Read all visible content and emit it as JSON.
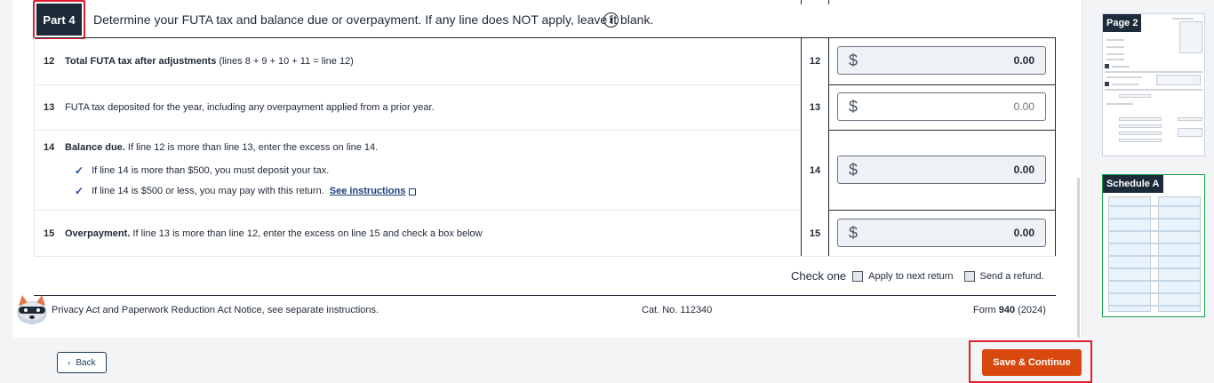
{
  "part": {
    "badge": "Part 4",
    "title": "Determine your FUTA tax and balance due or overpayment. If any line does NOT apply, leave it blank.",
    "info_icon": "info-circle-icon"
  },
  "lines": [
    {
      "num": "12",
      "bold": "Total FUTA tax after adjustments",
      "text": " (lines 8 + 9 + 10 + 11 = line 12)",
      "code": "12",
      "currency": "$",
      "amount": "0.00"
    },
    {
      "num": "13",
      "bold": "",
      "text": "FUTA tax deposited for the year, including any overpayment applied from a prior year.",
      "code": "13",
      "currency": "$",
      "amount": "0.00"
    },
    {
      "num": "14",
      "bold": "Balance due.",
      "text": " If line 12 is more than line 13, enter the excess on line 14.",
      "code": "14",
      "currency": "$",
      "amount": "0.00",
      "bullets": [
        "If line 14 is more than $500, you must deposit your tax.",
        "If line 14 is $500 or less, you may pay with this return."
      ],
      "link": "See instructions"
    },
    {
      "num": "15",
      "bold": "Overpayment.",
      "text": " If line 13 is more than line 12, enter the excess on line 15 and check a box below",
      "code": "15",
      "currency": "$",
      "amount": "0.00"
    }
  ],
  "check_one": {
    "label": "Check one",
    "options": [
      "Apply to next return",
      "Send a refund."
    ]
  },
  "footer": {
    "notice": "Privacy Act and Paperwork Reduction Act Notice, see separate instructions.",
    "cat_no": "Cat. No. 112340",
    "form_prefix": "Form ",
    "form_num": "940",
    "form_year": " (2024)"
  },
  "buttons": {
    "back": "Back",
    "save": "Save & Continue"
  },
  "thumbnails": [
    "Page 2",
    "Schedule A"
  ],
  "colors": {
    "badge_bg": "#1c2a3a",
    "highlight": "#e11d2e",
    "primary_button": "#d9480f",
    "schedule_border": "#16a34a"
  }
}
